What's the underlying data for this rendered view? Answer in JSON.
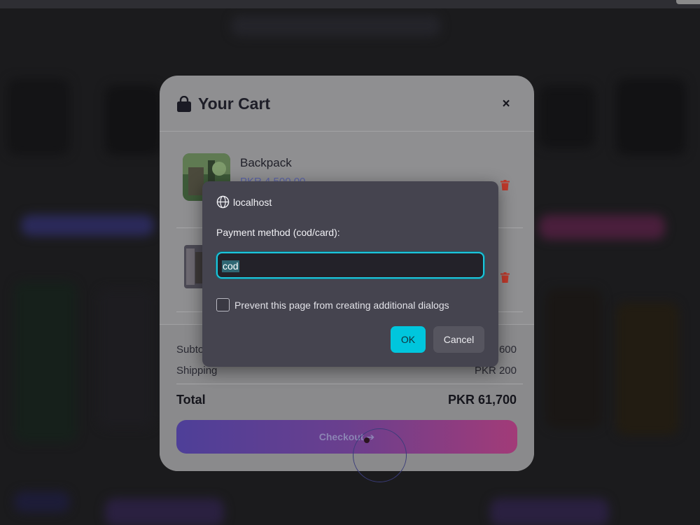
{
  "cart": {
    "title": "Your Cart",
    "icon": "shopping-bag-icon",
    "close": "×",
    "items": [
      {
        "name": "Backpack",
        "price": "PKR 4,500.00"
      },
      {
        "name": "",
        "price": ""
      }
    ],
    "summary": {
      "subtotal_label": "Subto",
      "subtotal_value": "600",
      "shipping_label": "Shipping",
      "shipping_value": "PKR 200",
      "total_label": "Total",
      "total_value": "PKR 61,700"
    },
    "checkout_label": "Checkout",
    "checkout_arrow": "➔"
  },
  "dialog": {
    "origin": "localhost",
    "message": "Payment method (cod/card):",
    "input_value": "cod",
    "checkbox_label": "Prevent this page from creating additional dialogs",
    "ok_label": "OK",
    "cancel_label": "Cancel"
  },
  "colors": {
    "accent": "#00c6dd",
    "trash": "#c0392b",
    "checkout_gradient_start": "#4e3f98",
    "checkout_gradient_end": "#a23b78"
  }
}
